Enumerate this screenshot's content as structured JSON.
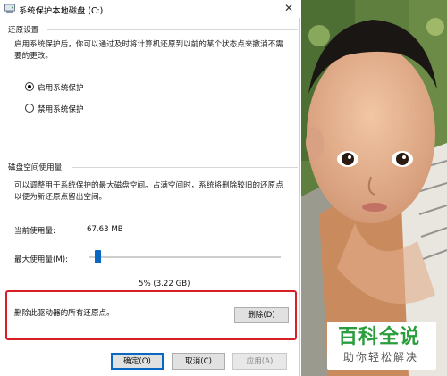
{
  "window": {
    "title": "系统保护本地磁盘 (C:)",
    "close_glyph": "✕"
  },
  "restore": {
    "section_title": "还原设置",
    "description": [
      "启用系统保护后，你可以通过及时将计算机还原到以前的某个状态点来撤消不需",
      "要的更改。"
    ],
    "options": [
      {
        "label": "启用系统保护",
        "selected": true
      },
      {
        "label": "禁用系统保护",
        "selected": false
      }
    ]
  },
  "disk": {
    "section_title": "磁盘空间使用量",
    "description": [
      "可以调整用于系统保护的最大磁盘空间。占满空间时，系统将删除较旧的还原点",
      "以便为新还原点留出空间。"
    ],
    "current_label": "当前使用量:",
    "current_value": "67.63 MB",
    "max_label": "最大使用量(M):",
    "slider_value_percent": 5,
    "slider_readout": "5% (3.22 GB)"
  },
  "delete": {
    "text": "删除此驱动器的所有还原点。",
    "button": "删除(D)"
  },
  "footer": {
    "ok": "确定(O)",
    "cancel": "取消(C)",
    "apply": "应用(A)"
  },
  "watermark": {
    "brand": "百科全说",
    "slogan": "助你轻松解决"
  },
  "colors": {
    "accent": "#0a67c2",
    "highlight_box": "#d81f26",
    "brand_green": "#2a9d3c"
  }
}
